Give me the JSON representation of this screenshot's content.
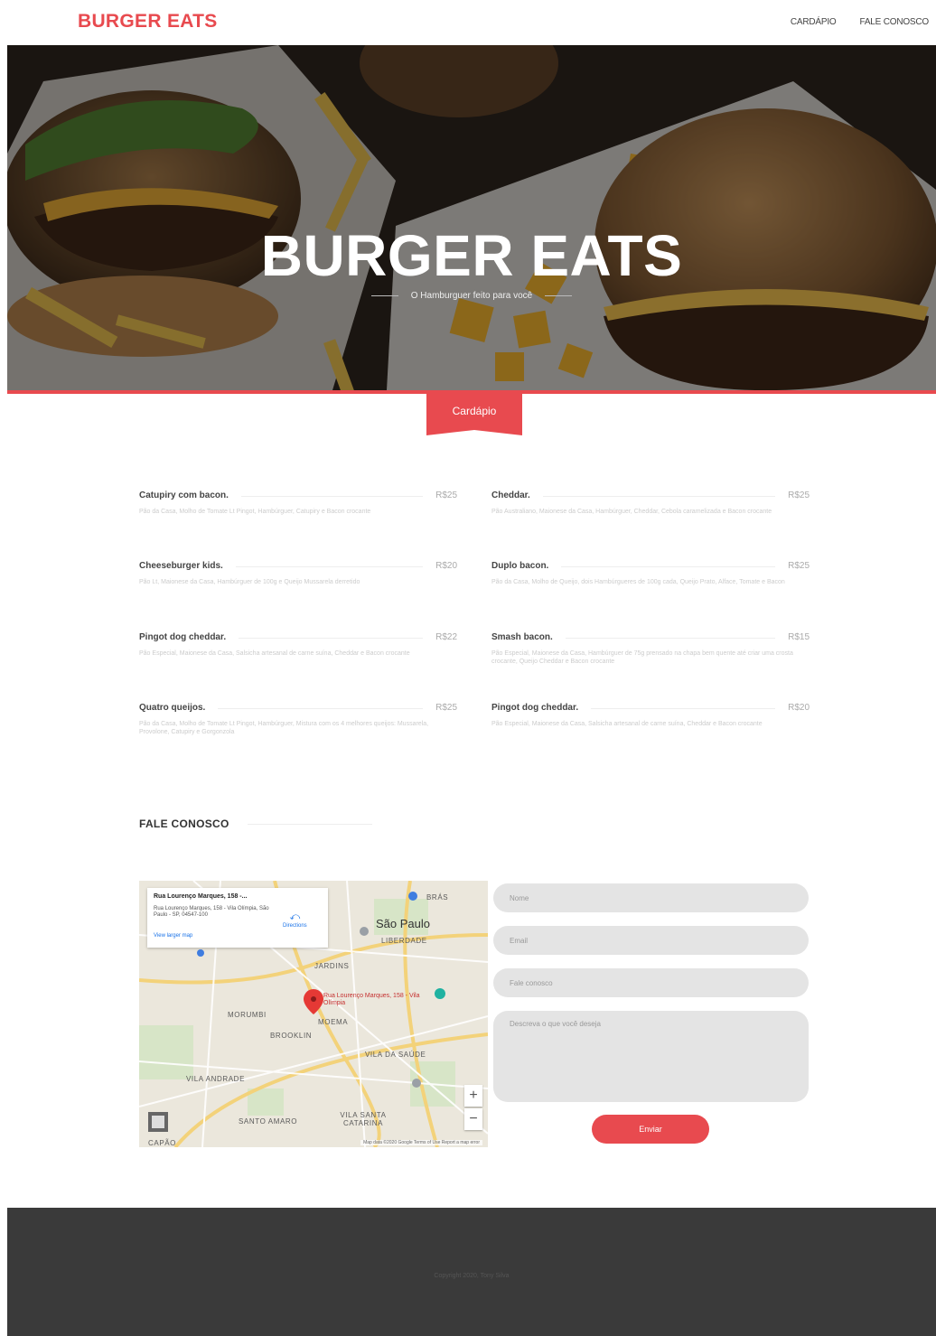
{
  "header": {
    "logo": "BURGER EATS",
    "nav": [
      "CARDÁPIO",
      "FALE CONOSCO"
    ]
  },
  "hero": {
    "title": "BURGER EATS",
    "subtitle": "O Hamburguer feito para você"
  },
  "menu_section": {
    "label": "Cardápio"
  },
  "menu": [
    {
      "name": "Catupiry com bacon.",
      "price": "R$25",
      "desc": "Pão da Casa, Molho de Tomate Lt Pingot, Hambúrguer, Catupiry e Bacon crocante"
    },
    {
      "name": "Cheddar.",
      "price": "R$25",
      "desc": "Pão Australiano, Maionese da Casa, Hambúrguer, Cheddar, Cebola caramelizada e Bacon crocante"
    },
    {
      "name": "Cheeseburger kids.",
      "price": "R$20",
      "desc": "Pão Lt, Maionese da Casa, Hambúrguer de 100g e Queijo Mussarela derretido"
    },
    {
      "name": "Duplo bacon.",
      "price": "R$25",
      "desc": "Pão da Casa, Molho de Queijo, dois Hambúrgueres de 100g cada, Queijo Prato, Alface, Tomate e Bacon"
    },
    {
      "name": "Pingot dog cheddar.",
      "price": "R$22",
      "desc": "Pão Especial, Maionese da Casa, Salsicha artesanal de carne suína, Cheddar e Bacon crocante"
    },
    {
      "name": "Smash bacon.",
      "price": "R$15",
      "desc": "Pão Especial, Maionese da Casa, Hambúrguer de 75g prensado na chapa bem quente até criar uma crosta crocante, Queijo Cheddar e Bacon crocante"
    },
    {
      "name": "Quatro queijos.",
      "price": "R$25",
      "desc": "Pão da Casa, Molho de Tomate Lt Pingot, Hambúrguer, Mistura com os 4 melhores queijos: Mussarela, Provolone, Catupiry e Gorgonzola"
    },
    {
      "name": "Pingot dog cheddar.",
      "price": "R$20",
      "desc": "Pão Especial, Maionese da Casa, Salsicha artesanal de carne suína, Cheddar e Bacon crocante"
    }
  ],
  "contact": {
    "title": "FALE CONOSCO",
    "map": {
      "card_title": "Rua Lourenço Marques, 158 -...",
      "card_address": "Rua Lourenço Marques, 158 - Vila Olímpia, São Paulo - SP, 04547-100",
      "card_link": "View larger map",
      "directions": "Directions",
      "pin_label": "Rua Lourenço Marques, 158 - Vila Olímpia",
      "places": [
        "BRÁS",
        "São Paulo",
        "LIBERDADE",
        "JARDINS",
        "MORUMBI",
        "MOEMA",
        "BROOKLIN",
        "VILA DA SAÚDE",
        "VILA ANDRADE",
        "SANTO AMARO",
        "VILA SANTA CATARINA",
        "CAPÃO"
      ],
      "zoom_in": "+",
      "zoom_out": "−",
      "footer_text": "Map data ©2020 Google    Terms of Use    Report a map error"
    },
    "form": {
      "name_placeholder": "Nome",
      "email_placeholder": "Email",
      "phone_placeholder": "Fale conosco",
      "message_placeholder": "Descreva o que você deseja",
      "submit": "Enviar"
    }
  },
  "footer": {
    "copyright": "Copyright 2020, Tony Silva"
  },
  "colors": {
    "accent": "#e84a4f",
    "footer_bg": "#3a3a3a",
    "field_bg": "#e4e4e4"
  }
}
